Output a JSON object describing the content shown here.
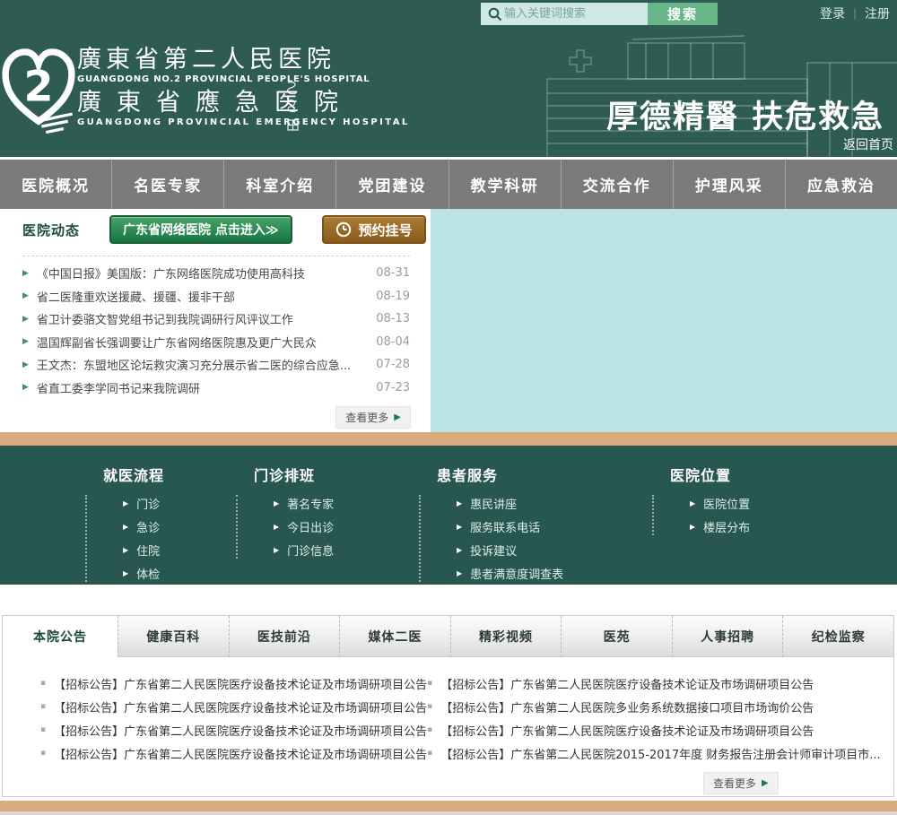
{
  "topbar": {
    "search_placeholder": "输入关键词搜索",
    "search_button": "搜索",
    "login": "登录",
    "divider": "|",
    "register": "注册"
  },
  "header": {
    "name_cn": "廣東省第二人民医院",
    "name_en": "GUANGDONG NO.2 PROVINCIAL PEOPLE'S HOSPITAL",
    "name2_cn": "廣東省應急医院",
    "name2_en": "GUANGDONG PROVINCIAL EMERGENCY HOSPITAL",
    "slogan": "厚德精醫 扶危救急",
    "back_home": "返回首页"
  },
  "nav": {
    "items": [
      {
        "label": "医院概况"
      },
      {
        "label": "名医专家"
      },
      {
        "label": "科室介绍"
      },
      {
        "label": "党团建设"
      },
      {
        "label": "教学科研"
      },
      {
        "label": "交流合作"
      },
      {
        "label": "护理风采"
      },
      {
        "label": "应急救治"
      }
    ]
  },
  "news": {
    "section_title": "医院动态",
    "network_button": "广东省网络医院 点击进入≫",
    "appointment_button": "预约挂号",
    "more_label": "查看更多",
    "more_arrow": "▶",
    "items": [
      {
        "title": "《中国日报》美国版：广东网络医院成功使用高科技",
        "date": "08-31"
      },
      {
        "title": "省二医隆重欢送援藏、援疆、援非干部",
        "date": "08-19"
      },
      {
        "title": "省卫计委骆文智党组书记到我院调研行风评议工作",
        "date": "08-13"
      },
      {
        "title": "温国辉副省长强调要让广东省网络医院惠及更广大民众",
        "date": "08-04"
      },
      {
        "title": "王文杰：东盟地区论坛救灾演习充分展示省二医的综合应急...",
        "date": "07-28"
      },
      {
        "title": "省直工委李学同书记来我院调研",
        "date": "07-23"
      }
    ]
  },
  "quicklinks": {
    "columns": [
      {
        "title": "就医流程",
        "links": [
          {
            "label": "门诊"
          },
          {
            "label": "急诊"
          },
          {
            "label": "住院"
          },
          {
            "label": "体检"
          }
        ]
      },
      {
        "title": "门诊排班",
        "links": [
          {
            "label": "著名专家"
          },
          {
            "label": "今日出诊"
          },
          {
            "label": "门诊信息"
          }
        ]
      },
      {
        "title": "患者服务",
        "links": [
          {
            "label": "惠民讲座"
          },
          {
            "label": "服务联系电话"
          },
          {
            "label": "投诉建议"
          },
          {
            "label": "患者满意度调查表"
          }
        ]
      },
      {
        "title": "医院位置",
        "links": [
          {
            "label": "医院位置"
          },
          {
            "label": "楼层分布"
          }
        ]
      }
    ]
  },
  "tabs": {
    "active": "本院公告",
    "items": [
      {
        "label": "本院公告"
      },
      {
        "label": "健康百科"
      },
      {
        "label": "医技前沿"
      },
      {
        "label": "媒体二医"
      },
      {
        "label": "精彩视频"
      },
      {
        "label": "医苑"
      },
      {
        "label": "人事招聘"
      },
      {
        "label": "纪检监察"
      }
    ],
    "more_label": "查看更多",
    "more_arrow": "▶",
    "left_list": [
      {
        "title": "【招标公告】广东省第二人民医院医疗设备技术论证及市场调研项目公告"
      },
      {
        "title": "【招标公告】广东省第二人民医院医疗设备技术论证及市场调研项目公告"
      },
      {
        "title": "【招标公告】广东省第二人民医院医疗设备技术论证及市场调研项目公告"
      },
      {
        "title": "【招标公告】广东省第二人民医院医疗设备技术论证及市场调研项目公告"
      }
    ],
    "right_list": [
      {
        "title": "【招标公告】广东省第二人民医院医疗设备技术论证及市场调研项目公告"
      },
      {
        "title": "【招标公告】广东省第二人民医院多业务系统数据接口项目市场询价公告"
      },
      {
        "title": "【招标公告】广东省第二人民医院医疗设备技术论证及市场调研项目公告"
      },
      {
        "title": "【招标公告】广东省第二人民医院2015-2017年度 财务报告注册会计师审计项目市..."
      }
    ]
  },
  "colors": {
    "header_green": "#2e5b52",
    "mid_green": "#275750",
    "nav_gray": "#7b7b7b",
    "search_button_green": "#68b588",
    "network_button_green": "#177440",
    "appointment_brown": "#8a5c1d",
    "banner_teal": "#bce3e3",
    "tan_bar": "#d7ab7e"
  }
}
